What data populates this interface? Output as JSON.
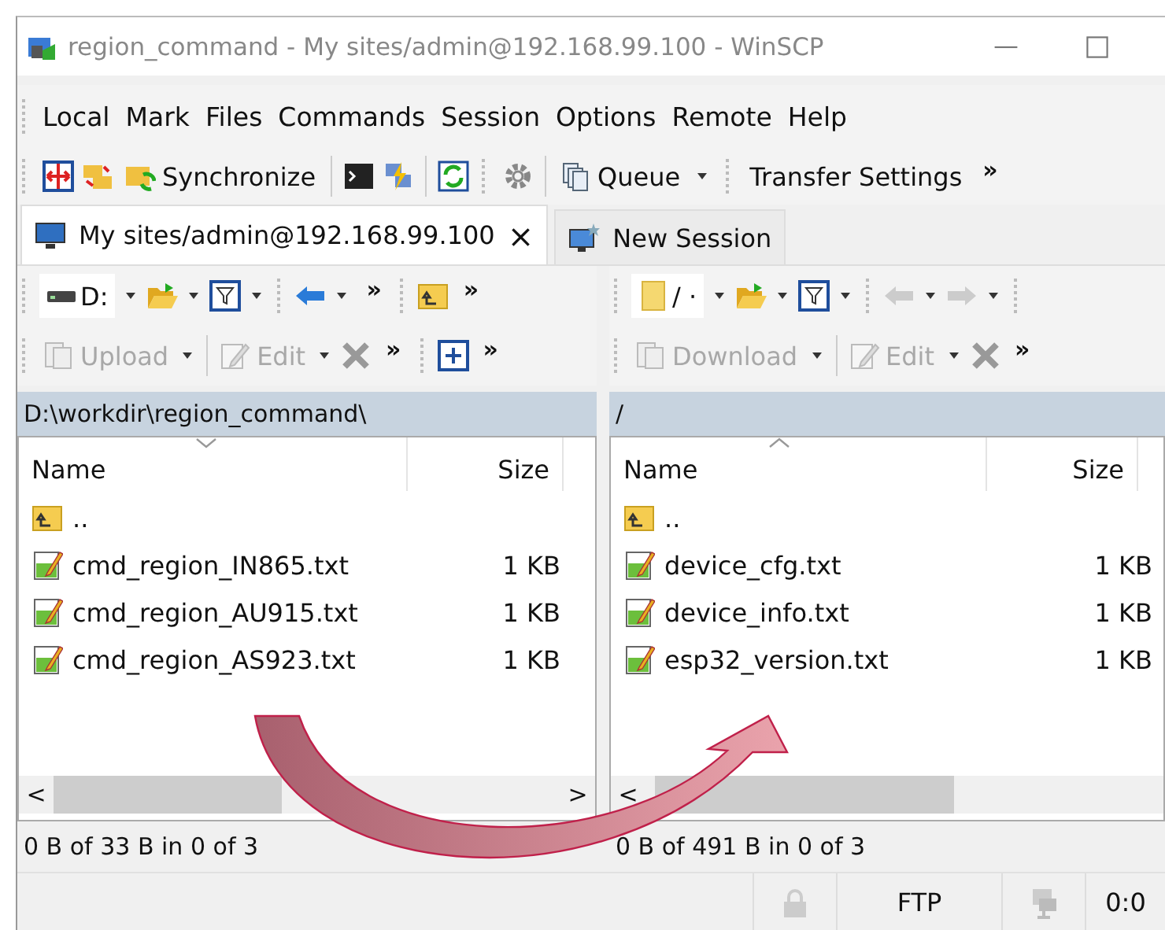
{
  "window": {
    "title": "region_command - My sites/admin@192.168.99.100 - WinSCP"
  },
  "menu": [
    "Local",
    "Mark",
    "Files",
    "Commands",
    "Session",
    "Options",
    "Remote",
    "Help"
  ],
  "toolbar": {
    "buttons": [
      {
        "label": "Synchronize"
      },
      {
        "label": "Queue",
        "dropdown": true
      },
      {
        "label": "Transfer Settings"
      }
    ],
    "overflow": "»"
  },
  "tabs": [
    {
      "label": "My sites/admin@192.168.99.100",
      "selected": true,
      "close": "×"
    },
    {
      "label": "New Session",
      "selected": false
    }
  ],
  "panels": [
    {
      "address": "D:",
      "overflow": "»",
      "buttons": [
        {
          "label": "Upload",
          "disabled": true
        },
        {
          "label": "Edit",
          "disabled": true
        }
      ],
      "path": "D:\\workdir\\region_command\\",
      "columns": [
        {
          "label": "Name",
          "ascending": false
        },
        {
          "label": "Size"
        }
      ],
      "scroll_arrows": [
        "<",
        ">"
      ],
      "rows": [
        {
          "name": "..",
          "size": "",
          "kind": "parent"
        },
        {
          "name": "cmd_region_IN865.txt",
          "size": "1 KB",
          "kind": "file"
        },
        {
          "name": "cmd_region_AU915.txt",
          "size": "1 KB",
          "kind": "file"
        },
        {
          "name": "cmd_region_AS923.txt",
          "size": "1 KB",
          "kind": "file"
        }
      ],
      "status": "0 B of 33 B in 0 of 3"
    },
    {
      "address": "/ ·",
      "overflow": "»",
      "buttons": [
        {
          "label": "Download",
          "disabled": true
        },
        {
          "label": "Edit",
          "disabled": true
        }
      ],
      "path": "/",
      "columns": [
        {
          "label": "Name",
          "ascending": true
        },
        {
          "label": "Size"
        }
      ],
      "scroll_arrows": [
        "<"
      ],
      "rows": [
        {
          "name": "..",
          "size": "",
          "kind": "parent"
        },
        {
          "name": "device_cfg.txt",
          "size": "1 KB",
          "kind": "file"
        },
        {
          "name": "device_info.txt",
          "size": "1 KB",
          "kind": "file"
        },
        {
          "name": "esp32_version.txt",
          "size": "1 KB",
          "kind": "file"
        }
      ],
      "status": "0 B of 491 B in 0 of 3"
    }
  ],
  "status_bar": {
    "protocol": "FTP",
    "time": "0:0"
  }
}
